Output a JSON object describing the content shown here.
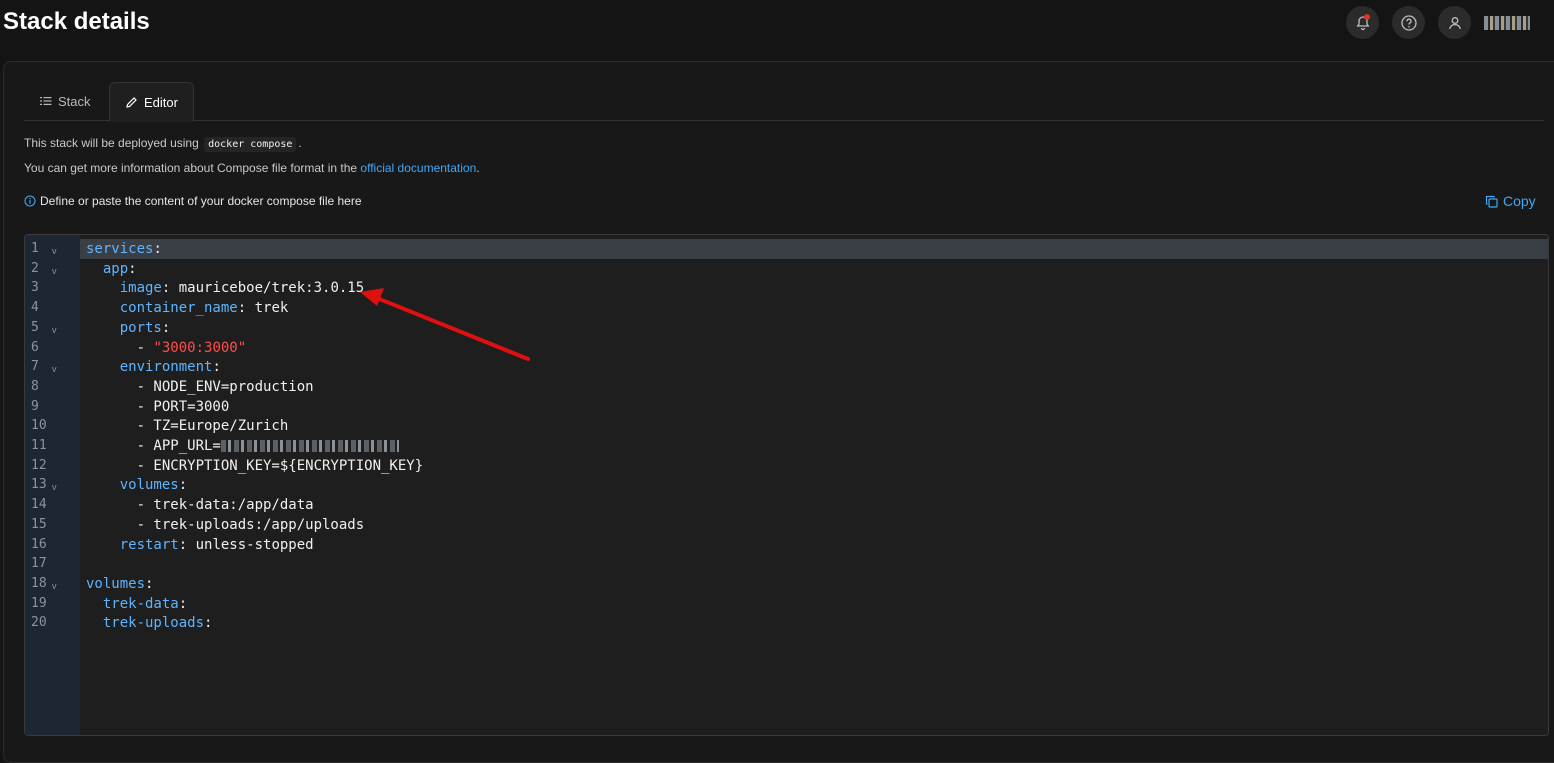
{
  "header": {
    "title": "Stack details"
  },
  "topbar": {
    "notification_icon": "bell-icon",
    "help_icon": "question-circle-icon",
    "user_icon": "user-icon",
    "accent": "#e0342b"
  },
  "tabs": [
    {
      "label": "Stack",
      "icon": "list-icon",
      "active": false
    },
    {
      "label": "Editor",
      "icon": "pencil-icon",
      "active": true
    }
  ],
  "info": {
    "line1_prefix": "This stack will be deployed using",
    "line1_code": "docker compose",
    "line1_suffix": ".",
    "line2_prefix": "You can get more information about Compose file format in the",
    "line2_link": "official documentation",
    "line2_suffix": ".",
    "hint": "Define or paste the content of your docker compose file here",
    "copy_label": "Copy"
  },
  "editor": {
    "lines": [
      {
        "num": "1",
        "fold": true,
        "parts": [
          {
            "t": "services",
            "c": "k"
          },
          {
            "t": ":",
            "c": ""
          }
        ]
      },
      {
        "num": "2",
        "fold": true,
        "parts": [
          {
            "t": "  ",
            "c": ""
          },
          {
            "t": "app",
            "c": "k"
          },
          {
            "t": ":",
            "c": ""
          }
        ]
      },
      {
        "num": "3",
        "fold": false,
        "parts": [
          {
            "t": "    ",
            "c": ""
          },
          {
            "t": "image",
            "c": "k"
          },
          {
            "t": ": mauriceboe/trek:3.0.15",
            "c": ""
          }
        ]
      },
      {
        "num": "4",
        "fold": false,
        "parts": [
          {
            "t": "    ",
            "c": ""
          },
          {
            "t": "container_name",
            "c": "k"
          },
          {
            "t": ": trek",
            "c": ""
          }
        ]
      },
      {
        "num": "5",
        "fold": true,
        "parts": [
          {
            "t": "    ",
            "c": ""
          },
          {
            "t": "ports",
            "c": "k"
          },
          {
            "t": ":",
            "c": ""
          }
        ]
      },
      {
        "num": "6",
        "fold": false,
        "parts": [
          {
            "t": "      - ",
            "c": ""
          },
          {
            "t": "\"3000:3000\"",
            "c": "s"
          }
        ]
      },
      {
        "num": "7",
        "fold": true,
        "parts": [
          {
            "t": "    ",
            "c": ""
          },
          {
            "t": "environment",
            "c": "k"
          },
          {
            "t": ":",
            "c": ""
          }
        ]
      },
      {
        "num": "8",
        "fold": false,
        "parts": [
          {
            "t": "      - NODE_ENV=production",
            "c": ""
          }
        ]
      },
      {
        "num": "9",
        "fold": false,
        "parts": [
          {
            "t": "      - PORT=3000",
            "c": ""
          }
        ]
      },
      {
        "num": "10",
        "fold": false,
        "parts": [
          {
            "t": "      - TZ=Europe/Zurich",
            "c": ""
          }
        ]
      },
      {
        "num": "11",
        "fold": false,
        "parts": [
          {
            "t": "      - APP_URL=",
            "c": ""
          }
        ],
        "redacted": true
      },
      {
        "num": "12",
        "fold": false,
        "parts": [
          {
            "t": "      - ENCRYPTION_KEY=${ENCRYPTION_KEY}",
            "c": ""
          }
        ]
      },
      {
        "num": "13",
        "fold": true,
        "parts": [
          {
            "t": "    ",
            "c": ""
          },
          {
            "t": "volumes",
            "c": "k"
          },
          {
            "t": ":",
            "c": ""
          }
        ]
      },
      {
        "num": "14",
        "fold": false,
        "parts": [
          {
            "t": "      - trek-data:/app/data",
            "c": ""
          }
        ]
      },
      {
        "num": "15",
        "fold": false,
        "parts": [
          {
            "t": "      - trek-uploads:/app/uploads",
            "c": ""
          }
        ]
      },
      {
        "num": "16",
        "fold": false,
        "parts": [
          {
            "t": "    ",
            "c": ""
          },
          {
            "t": "restart",
            "c": "k"
          },
          {
            "t": ": unless-stopped",
            "c": ""
          }
        ]
      },
      {
        "num": "17",
        "fold": false,
        "parts": []
      },
      {
        "num": "18",
        "fold": true,
        "parts": [
          {
            "t": "volumes",
            "c": "k"
          },
          {
            "t": ":",
            "c": ""
          }
        ]
      },
      {
        "num": "19",
        "fold": false,
        "parts": [
          {
            "t": "  ",
            "c": ""
          },
          {
            "t": "trek-data",
            "c": "k"
          },
          {
            "t": ":",
            "c": ""
          }
        ]
      },
      {
        "num": "20",
        "fold": false,
        "parts": [
          {
            "t": "  ",
            "c": ""
          },
          {
            "t": "trek-uploads",
            "c": "k"
          },
          {
            "t": ":",
            "c": ""
          }
        ]
      }
    ]
  },
  "annotation": {
    "arrow_color": "#e01010"
  }
}
